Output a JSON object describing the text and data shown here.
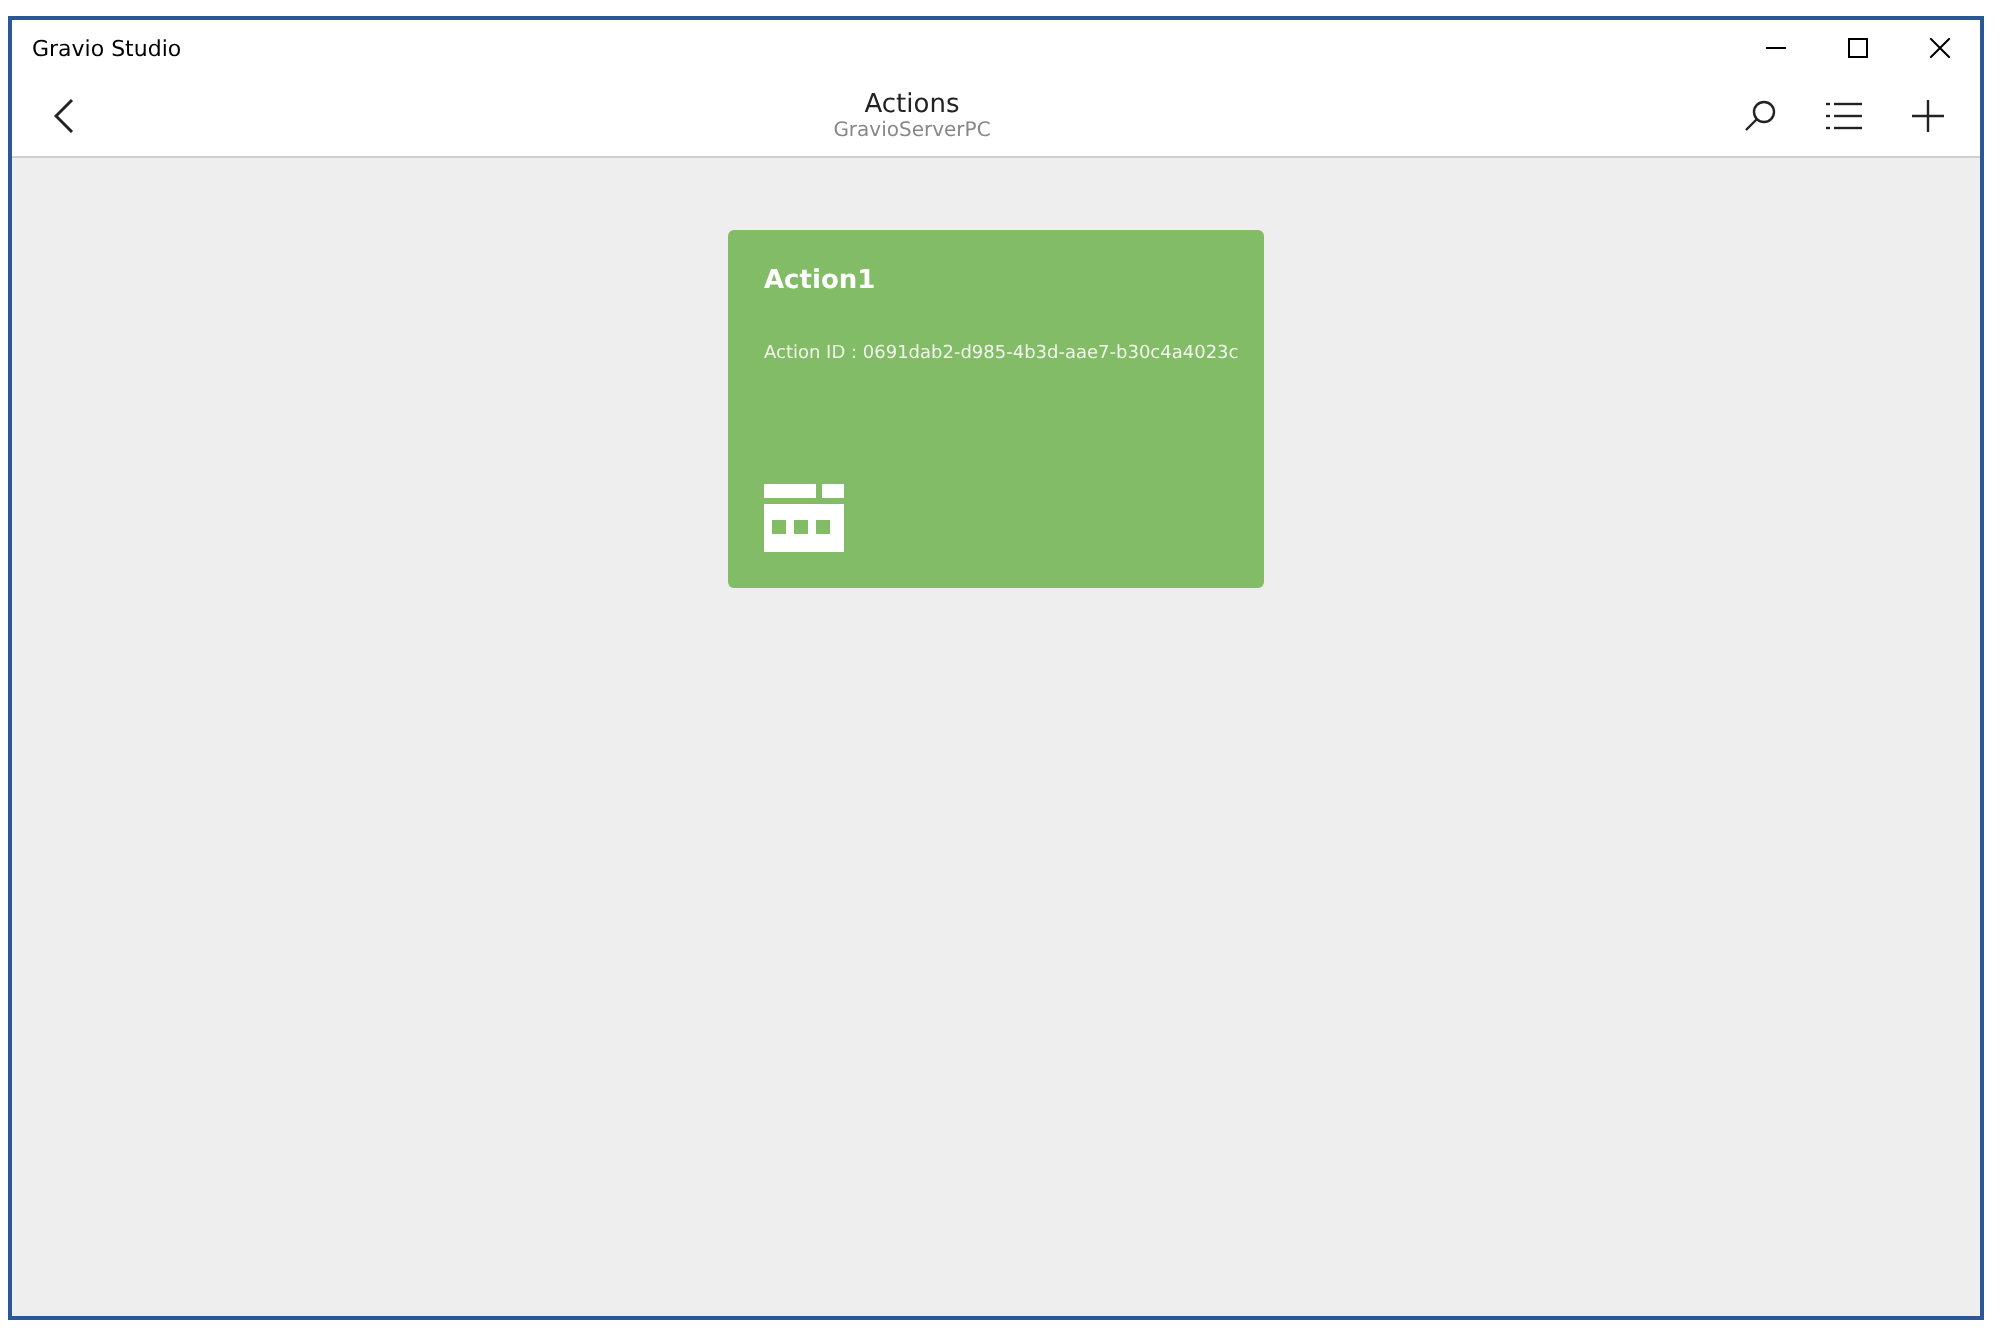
{
  "window": {
    "title": "Gravio Studio"
  },
  "header": {
    "title": "Actions",
    "subtitle": "GravioServerPC"
  },
  "cards": [
    {
      "title": "Action1",
      "id_text": "Action ID : 0691dab2-d985-4b3d-aae7-b30c4a4023c",
      "color": "#83bc66"
    }
  ]
}
